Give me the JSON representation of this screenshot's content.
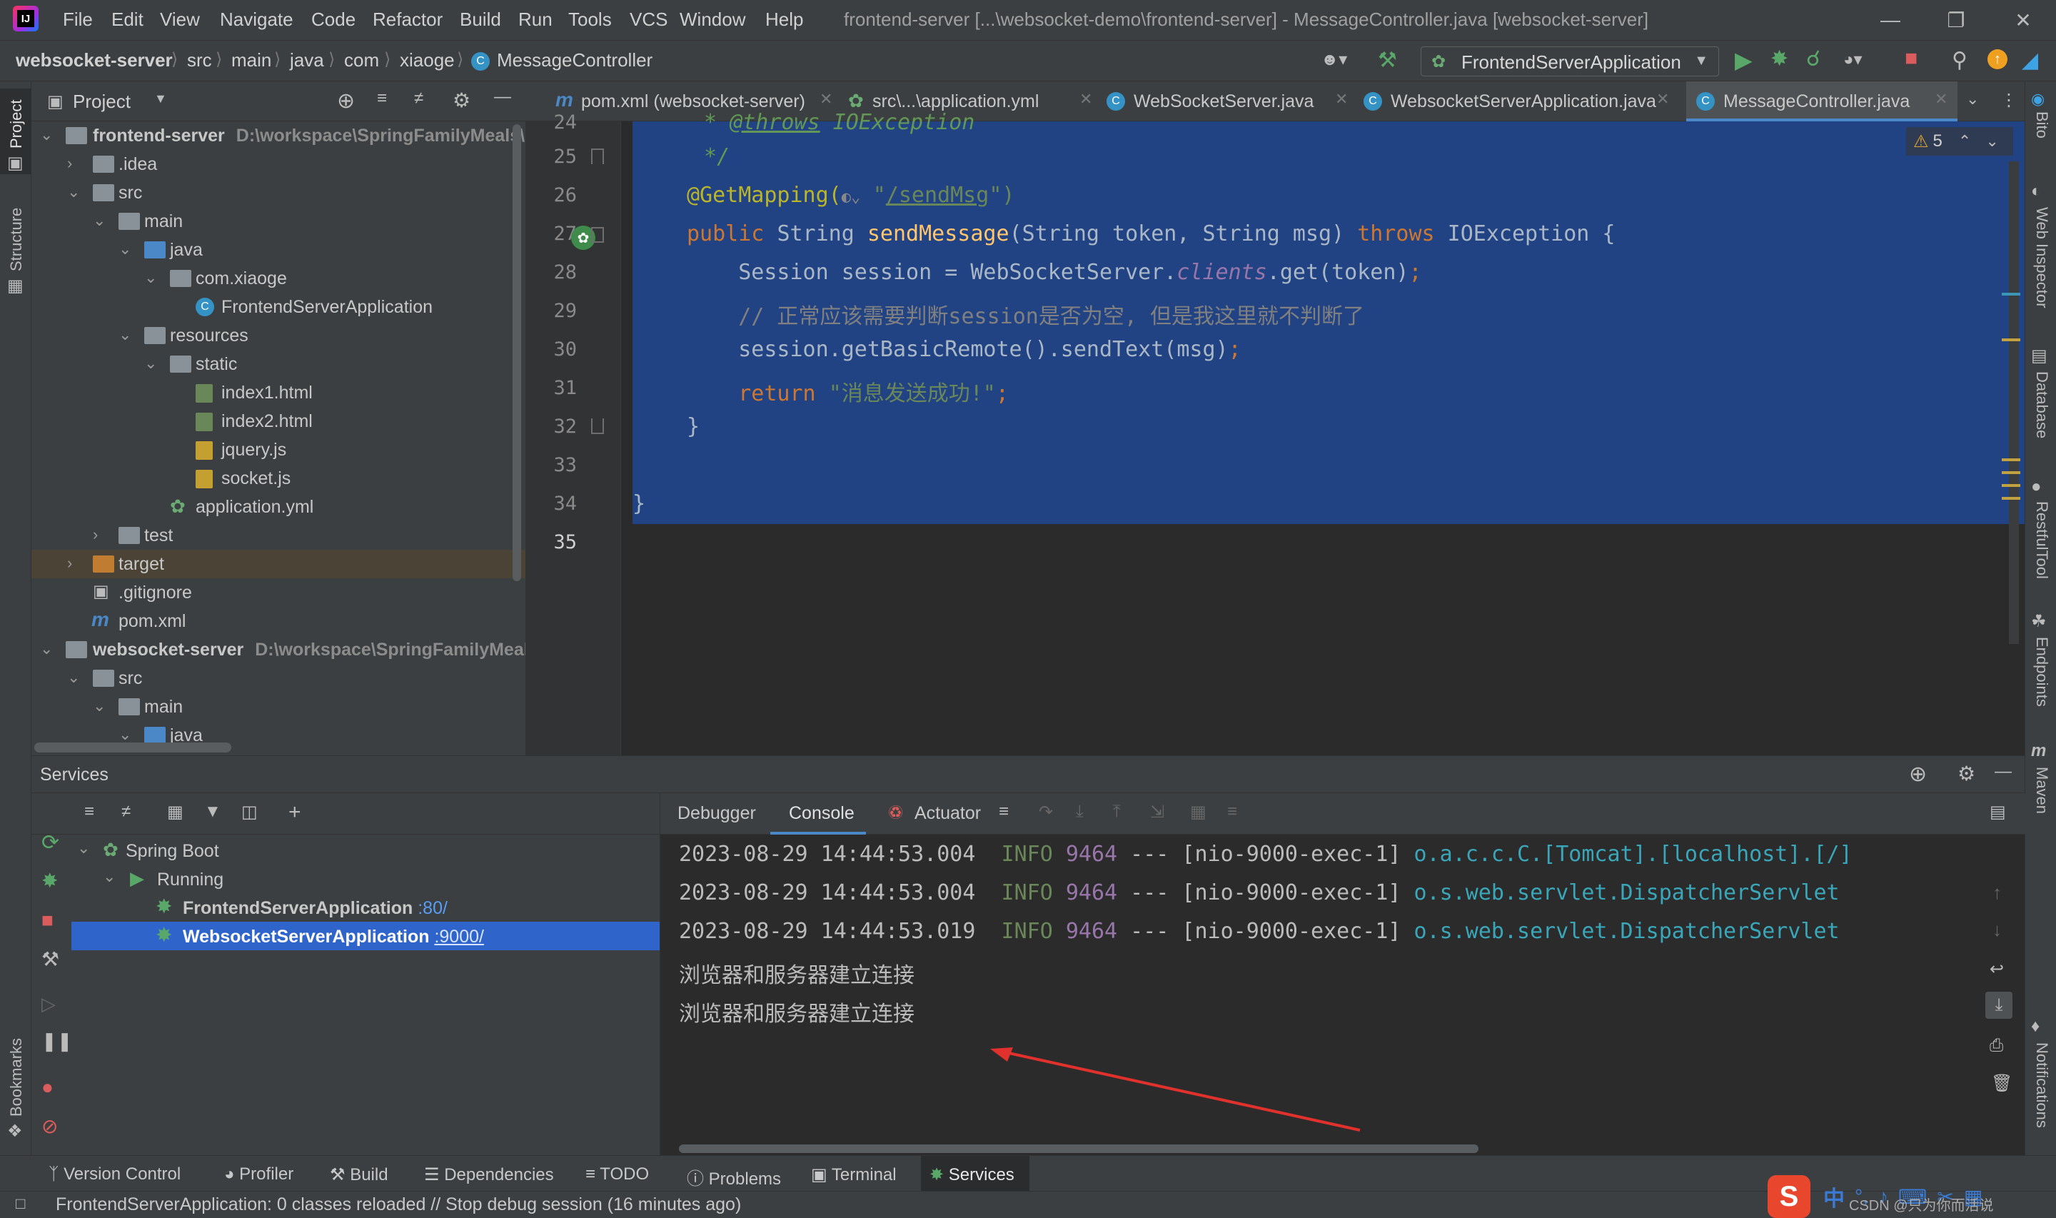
{
  "menu": {
    "items": [
      "File",
      "Edit",
      "View",
      "Navigate",
      "Code",
      "Refactor",
      "Build",
      "Run",
      "Tools",
      "VCS",
      "Window",
      "Help"
    ],
    "window_title": "frontend-server [...\\websocket-demo\\frontend-server] - MessageController.java [websocket-server]"
  },
  "breadcrumbs": [
    "websocket-server",
    "src",
    "main",
    "java",
    "com",
    "xiaoge",
    "MessageController"
  ],
  "run_config": "FrontendServerApplication",
  "left_stripe": [
    "Project",
    "Structure",
    "Bookmarks"
  ],
  "right_stripe": [
    "Bito",
    "Web Inspector",
    "Database",
    "RestfulTool",
    "Endpoints",
    "Maven",
    "Notifications"
  ],
  "project": {
    "title": "Project",
    "tree": [
      {
        "label": "frontend-server",
        "path": "D:\\workspace\\SpringFamilyMeals\\",
        "bold": true
      },
      {
        "label": ".idea"
      },
      {
        "label": "src"
      },
      {
        "label": "main"
      },
      {
        "label": "java"
      },
      {
        "label": "com.xiaoge"
      },
      {
        "label": "FrontendServerApplication"
      },
      {
        "label": "resources"
      },
      {
        "label": "static"
      },
      {
        "label": "index1.html"
      },
      {
        "label": "index2.html"
      },
      {
        "label": "jquery.js"
      },
      {
        "label": "socket.js"
      },
      {
        "label": "application.yml"
      },
      {
        "label": "test"
      },
      {
        "label": "target"
      },
      {
        "label": ".gitignore"
      },
      {
        "label": "pom.xml"
      },
      {
        "label": "websocket-server",
        "path": "D:\\workspace\\SpringFamilyMeals\\",
        "bold": true
      },
      {
        "label": "src"
      },
      {
        "label": "main"
      },
      {
        "label": "java"
      }
    ]
  },
  "editor_tabs": [
    "pom.xml (websocket-server)",
    "src\\...\\application.yml",
    "WebSocketServer.java",
    "WebsocketServerApplication.java",
    "MessageController.java"
  ],
  "editor": {
    "warnings": "5",
    "line_numbers": [
      "24",
      "25",
      "26",
      "27",
      "28",
      "29",
      "30",
      "31",
      "32",
      "33",
      "34",
      "35"
    ],
    "lines": {
      "l24_a": " * ",
      "l24_b": "@throws",
      "l24_c": " IOException",
      "l25": " */",
      "l26_a": "@GetMapping(",
      "l26_b": "\"",
      "l26_c": "/sendMsg",
      "l26_d": "\")",
      "l27_a": "public ",
      "l27_b": "String ",
      "l27_c": "sendMessage",
      "l27_d": "(String token, String msg) ",
      "l27_e": "throws ",
      "l27_f": "IOException {",
      "l28_a": "    Session session = WebSocketServer.",
      "l28_b": "clients",
      "l28_c": ".get(token)",
      "l28_d": ";",
      "l29": "    // 正常应该需要判断session是否为空, 但是我这里就不判断了",
      "l30_a": "    session.getBasicRemote().sendText(msg)",
      "l30_b": ";",
      "l31_a": "    return ",
      "l31_b": "\"消息发送成功!\"",
      "l31_c": ";",
      "l32": "}",
      "l34": "}"
    }
  },
  "services": {
    "title": "Services",
    "tree": {
      "root": "Spring Boot",
      "group": "Running",
      "apps": [
        {
          "name": "FrontendServerApplication",
          "port": ":80/"
        },
        {
          "name": "WebsocketServerApplication",
          "port": ":9000/"
        }
      ]
    },
    "console_tabs": [
      "Debugger",
      "Console",
      "Actuator"
    ],
    "log_lines": [
      {
        "ts": "2023-08-29 14:44:53.004",
        "level": "INFO",
        "pid": "9464",
        "sep": "---",
        "thread": "[nio-9000-exec-1]",
        "logger": "o.a.c.c.C.[Tomcat].[localhost].[/]"
      },
      {
        "ts": "2023-08-29 14:44:53.004",
        "level": "INFO",
        "pid": "9464",
        "sep": "---",
        "thread": "[nio-9000-exec-1]",
        "logger": "o.s.web.servlet.DispatcherServlet"
      },
      {
        "ts": "2023-08-29 14:44:53.019",
        "level": "INFO",
        "pid": "9464",
        "sep": "---",
        "thread": "[nio-9000-exec-1]",
        "logger": "o.s.web.servlet.DispatcherServlet"
      }
    ],
    "messages": [
      "浏览器和服务器建立连接",
      "浏览器和服务器建立连接"
    ]
  },
  "bottom_tools": [
    "Version Control",
    "Profiler",
    "Build",
    "Dependencies",
    "TODO",
    "Problems",
    "Terminal",
    "Services"
  ],
  "status": "FrontendServerApplication: 0 classes reloaded // Stop debug session (16 minutes ago)",
  "ime": {
    "logo": "S",
    "mode": "中"
  },
  "watermark": "CSDN @只为你而活说",
  "colors": {
    "selection": "#214283",
    "accent": "#4a88c7",
    "annotation_arrow": "#e0312c",
    "selected_row": "#2f65ca"
  }
}
